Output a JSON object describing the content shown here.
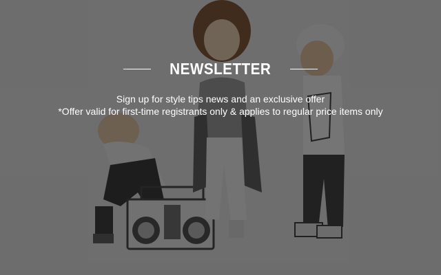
{
  "newsletter": {
    "title": "NEWSLETTER",
    "line1": "Sign up for style tips news and an exclusive offer",
    "line2": "*Offer valid for first-time registrants only & applies to regular price items only"
  },
  "colors": {
    "text": "#ffffff",
    "overlay": "#141414"
  }
}
